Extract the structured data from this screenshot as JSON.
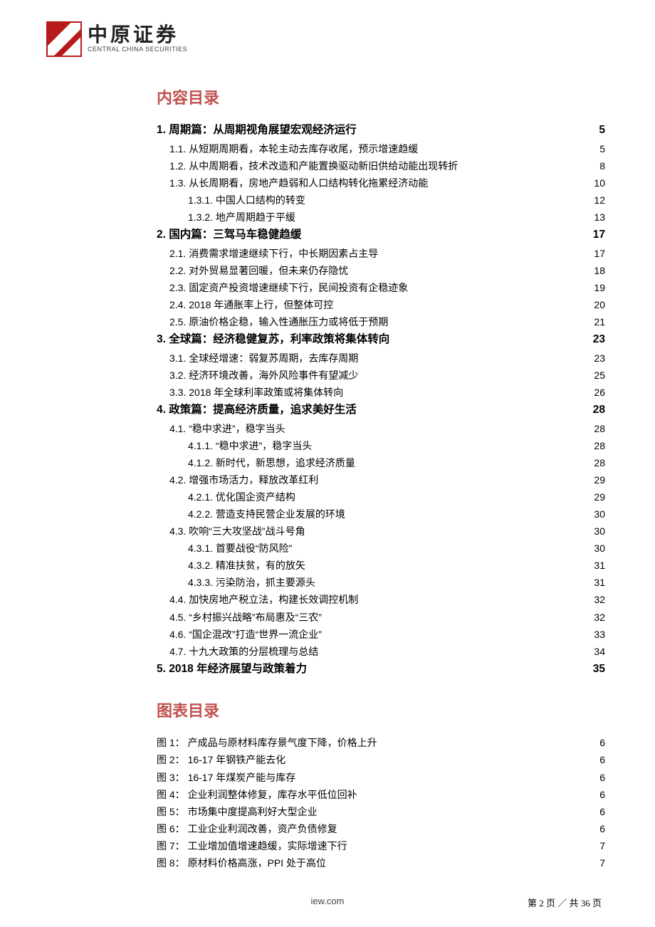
{
  "brand": {
    "cn": "中原证券",
    "en": "CENTRAL CHINA SECURITIES"
  },
  "headings": {
    "toc": "内容目录",
    "figures": "图表目录"
  },
  "toc": [
    {
      "level": 1,
      "num": "1.",
      "title": "周期篇：从周期视角展望宏观经济运行",
      "page": "5"
    },
    {
      "level": 2,
      "num": "1.1.",
      "title": "从短期周期看，本轮主动去库存收尾，预示增速趋缓",
      "page": "5"
    },
    {
      "level": 2,
      "num": "1.2.",
      "title": "从中周期看，技术改造和产能置换驱动新旧供给动能出现转折",
      "page": "8"
    },
    {
      "level": 2,
      "num": "1.3.",
      "title": "从长周期看，房地产趋弱和人口结构转化拖累经济动能",
      "page": "10"
    },
    {
      "level": 3,
      "num": "1.3.1.",
      "title": "中国人口结构的转变",
      "page": "12"
    },
    {
      "level": 3,
      "num": "1.3.2.",
      "title": "地产周期趋于平缓",
      "page": "13"
    },
    {
      "level": 1,
      "num": "2.",
      "title": "国内篇：三驾马车稳健趋缓",
      "page": "17"
    },
    {
      "level": 2,
      "num": "2.1.",
      "title": "消费需求增速继续下行，中长期因素占主导",
      "page": "17"
    },
    {
      "level": 2,
      "num": "2.2.",
      "title": "对外贸易显著回暖，但未来仍存隐忧",
      "page": "18"
    },
    {
      "level": 2,
      "num": "2.3.",
      "title": "固定资产投资增速继续下行，民间投资有企稳迹象",
      "page": "19"
    },
    {
      "level": 2,
      "num": "2.4.",
      "title": "2018 年通胀率上行，但整体可控",
      "page": "20"
    },
    {
      "level": 2,
      "num": "2.5.",
      "title": "原油价格企稳，输入性通胀压力或将低于预期",
      "page": "21"
    },
    {
      "level": 1,
      "num": "3.",
      "title": "全球篇：经济稳健复苏，利率政策将集体转向",
      "page": "23"
    },
    {
      "level": 2,
      "num": "3.1.",
      "title": "全球经增速：弱复苏周期，去库存周期",
      "page": "23"
    },
    {
      "level": 2,
      "num": "3.2.",
      "title": "经济环境改善，海外风险事件有望减少",
      "page": "25"
    },
    {
      "level": 2,
      "num": "3.3.",
      "title": "2018 年全球利率政策或将集体转向",
      "page": "26"
    },
    {
      "level": 1,
      "num": "4.",
      "title": "政策篇：提高经济质量，追求美好生活",
      "page": "28"
    },
    {
      "level": 2,
      "num": "4.1.",
      "title": "“稳中求进”，稳字当头",
      "page": "28"
    },
    {
      "level": 3,
      "num": "4.1.1.",
      "title": "“稳中求进”，稳字当头",
      "page": "28"
    },
    {
      "level": 3,
      "num": "4.1.2.",
      "title": "新时代，新思想，追求经济质量",
      "page": "28"
    },
    {
      "level": 2,
      "num": "4.2.",
      "title": "增强市场活力，释放改革红利",
      "page": "29"
    },
    {
      "level": 3,
      "num": "4.2.1.",
      "title": "优化国企资产结构",
      "page": "29"
    },
    {
      "level": 3,
      "num": "4.2.2.",
      "title": "营造支持民营企业发展的环境",
      "page": "30"
    },
    {
      "level": 2,
      "num": "4.3.",
      "title": "吹响“三大攻坚战”战斗号角",
      "page": "30"
    },
    {
      "level": 3,
      "num": "4.3.1.",
      "title": "首要战役“防风险”",
      "page": "30"
    },
    {
      "level": 3,
      "num": "4.3.2.",
      "title": "精准扶贫，有的放矢",
      "page": "31"
    },
    {
      "level": 3,
      "num": "4.3.3.",
      "title": "污染防治，抓主要源头",
      "page": "31"
    },
    {
      "level": 2,
      "num": "4.4.",
      "title": "加快房地产税立法，构建长效调控机制",
      "page": "32"
    },
    {
      "level": 2,
      "num": "4.5.",
      "title": "“乡村振兴战略”布局惠及“三农”",
      "page": "32"
    },
    {
      "level": 2,
      "num": "4.6.",
      "title": "“国企混改”打造“世界一流企业”",
      "page": "33"
    },
    {
      "level": 2,
      "num": "4.7.",
      "title": "十九大政策的分层梳理与总结",
      "page": "34"
    },
    {
      "level": 1,
      "num": "5.",
      "title": "2018 年经济展望与政策着力",
      "page": "35"
    }
  ],
  "figures": [
    {
      "num": "图 1：",
      "title": "产成品与原材料库存景气度下降，价格上升",
      "page": "6"
    },
    {
      "num": "图 2：",
      "title": "16-17 年钢铁产能去化",
      "page": "6"
    },
    {
      "num": "图 3：",
      "title": "16-17 年煤炭产能与库存",
      "page": "6"
    },
    {
      "num": "图 4：",
      "title": "企业利润整体修复，库存水平低位回补",
      "page": "6"
    },
    {
      "num": "图 5：",
      "title": "市场集中度提高利好大型企业",
      "page": "6"
    },
    {
      "num": "图 6：",
      "title": "工业企业利润改善，资产负债修复",
      "page": "6"
    },
    {
      "num": "图 7：",
      "title": "工业增加值增速趋缓，实际增速下行",
      "page": "7"
    },
    {
      "num": "图 8：",
      "title": "原材料价格高涨，PPI 处于高位",
      "page": "7"
    }
  ],
  "footer": {
    "url_fragment": "iew.com",
    "page_label": "第 2 页 ／ 共 36 页"
  }
}
